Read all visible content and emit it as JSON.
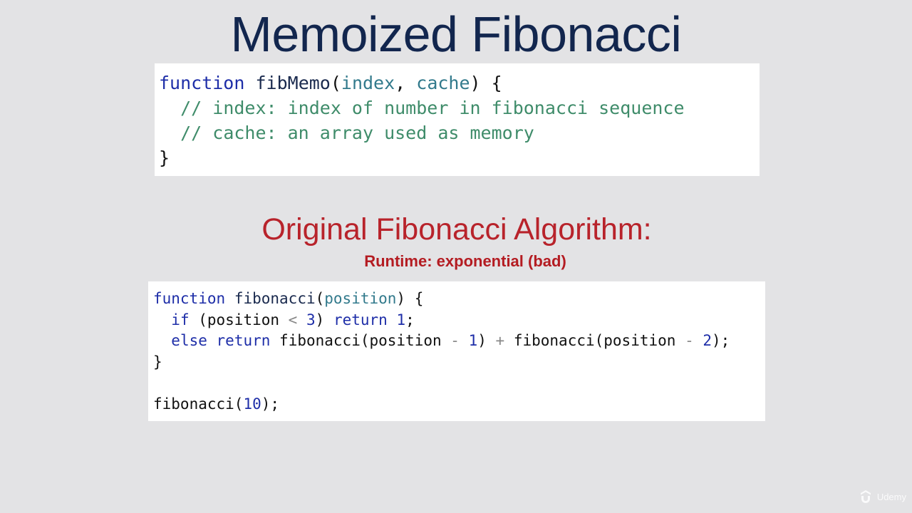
{
  "slide": {
    "title": "Memoized Fibonacci",
    "subtitle": "Original Fibonacci Algorithm:",
    "runtime_label": "Runtime: exponential (bad)"
  },
  "memo_code": {
    "kw_function": "function",
    "fn_name": "fibMemo",
    "open_paren": "(",
    "param_index": "index",
    "comma": ", ",
    "param_cache": "cache",
    "close_sig": ") {",
    "comment1": "// index: index of number in fibonacci sequence",
    "comment2": "// cache: an array used as memory",
    "close_brace": "}"
  },
  "original_code": {
    "kw_function": "function",
    "fn_name": "fibonacci",
    "open_paren": "(",
    "param_position": "position",
    "close_sig": ") {",
    "kw_if": "if",
    "if_open": " (position ",
    "op_lt": "<",
    "num_3": "3",
    "if_close": ") ",
    "kw_return1": "return",
    "num_1a": "1",
    "semi1": ";",
    "kw_else": "else",
    "kw_return2": "return",
    "call1": "fibonacci(position ",
    "op_minus1": "-",
    "num_1b": "1",
    "close1": ") ",
    "op_plus": "+",
    "call2": " fibonacci(position ",
    "op_minus2": "-",
    "num_2": "2",
    "close2": ");",
    "close_brace": "}",
    "invoke_call": "fibonacci(",
    "invoke_num": "10",
    "invoke_close": ");"
  },
  "watermark": {
    "brand": "Udemy"
  }
}
